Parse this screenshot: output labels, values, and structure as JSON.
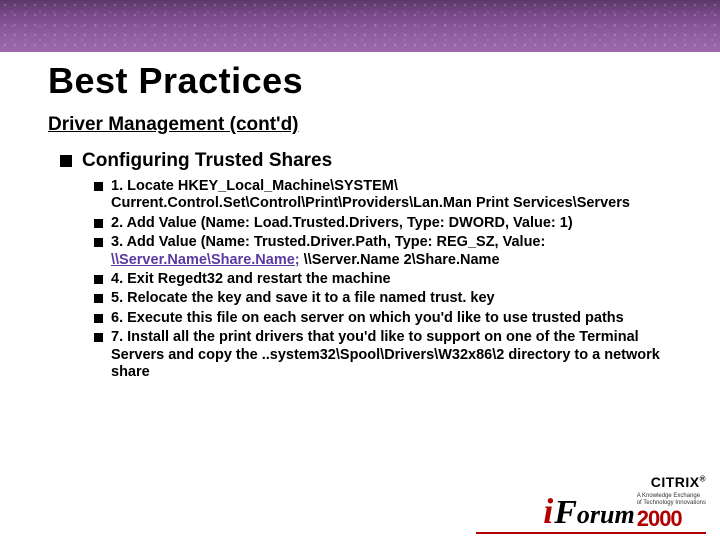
{
  "title": "Best Practices",
  "subtitle": "Driver Management (cont'd)",
  "section_heading": "Configuring Trusted Shares",
  "steps": [
    {
      "pre": "1. Locate HKEY_Local_Machine\\SYSTEM\\ Current.Control.Set\\Control\\Print\\Providers\\Lan.Man Print Services\\Servers",
      "link": "",
      "post": ""
    },
    {
      "pre": "2. Add Value (Name: Load.Trusted.Drivers, Type: DWORD, Value: 1)",
      "link": "",
      "post": ""
    },
    {
      "pre": "3. Add Value (Name: Trusted.Driver.Path, Type: REG_SZ, Value: ",
      "link": "\\\\Server.Name\\Share.Name;",
      "post": " \\\\Server.Name 2\\Share.Name"
    },
    {
      "pre": "4. Exit Regedt32 and restart the machine",
      "link": "",
      "post": ""
    },
    {
      "pre": "5. Relocate the key and save it to a file named trust. key",
      "link": "",
      "post": ""
    },
    {
      "pre": "6. Execute this file on each server on which you'd like to use trusted paths",
      "link": "",
      "post": ""
    },
    {
      "pre": "7. Install all the print drivers that you'd like to support on one of the Terminal Servers and copy the ..system32\\Spool\\Drivers\\W32x86\\2 directory to a network share",
      "link": "",
      "post": ""
    }
  ],
  "footer": {
    "brand": "CITRIX",
    "reg": "®",
    "i": "i",
    "F": "F",
    "orum": "orum",
    "tag1": "A Knowledge Exchange",
    "tag2": "of Technology Innovations",
    "year": "2000"
  }
}
